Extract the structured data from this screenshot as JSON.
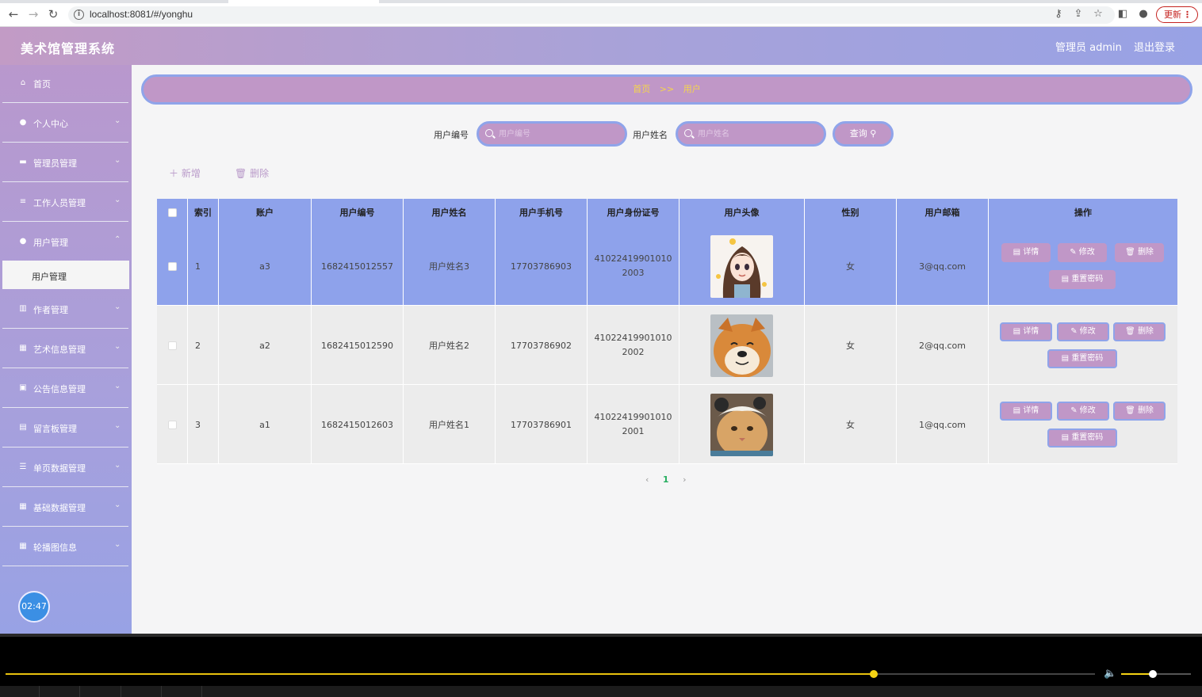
{
  "browser": {
    "url": "localhost:8081/#/yonghu",
    "update_label": "更新"
  },
  "header": {
    "title": "美术馆管理系统",
    "admin": "管理员 admin",
    "logout": "退出登录"
  },
  "sidebar": {
    "items": [
      {
        "label": "首页",
        "icon": "home-icon"
      },
      {
        "label": "个人中心",
        "icon": "user-icon"
      },
      {
        "label": "管理员管理",
        "icon": "admin-icon"
      },
      {
        "label": "工作人员管理",
        "icon": "list-icon"
      },
      {
        "label": "用户管理",
        "icon": "user-manage-icon"
      },
      {
        "label": "作者管理",
        "icon": "chart-icon"
      },
      {
        "label": "艺术信息管理",
        "icon": "grid-icon"
      },
      {
        "label": "公告信息管理",
        "icon": "notice-icon"
      },
      {
        "label": "留言板管理",
        "icon": "message-icon"
      },
      {
        "label": "单页数据管理",
        "icon": "settings-icon"
      },
      {
        "label": "基础数据管理",
        "icon": "grid-icon"
      },
      {
        "label": "轮播图信息",
        "icon": "grid-icon"
      }
    ],
    "sub_item": "用户管理",
    "clock": "02:47"
  },
  "breadcrumb": {
    "home": "首页",
    "sep": ">>",
    "current": "用户"
  },
  "search": {
    "field1_label": "用户编号",
    "field1_placeholder": "用户编号",
    "field2_label": "用户姓名",
    "field2_placeholder": "用户姓名",
    "query_label": "查询"
  },
  "actions": {
    "add": "新增",
    "delete": "删除"
  },
  "table": {
    "headers": [
      "索引",
      "账户",
      "用户编号",
      "用户姓名",
      "用户手机号",
      "用户身份证号",
      "用户头像",
      "性别",
      "用户邮箱",
      "操作"
    ],
    "rows": [
      {
        "index": "1",
        "account": "a3",
        "number": "1682415012557",
        "name": "用户姓名3",
        "phone": "17703786903",
        "id_card": "410224199010102003",
        "gender": "女",
        "email": "3@qq.com"
      },
      {
        "index": "2",
        "account": "a2",
        "number": "1682415012590",
        "name": "用户姓名2",
        "phone": "17703786902",
        "id_card": "410224199010102002",
        "gender": "女",
        "email": "2@qq.com"
      },
      {
        "index": "3",
        "account": "a1",
        "number": "1682415012603",
        "name": "用户姓名1",
        "phone": "17703786901",
        "id_card": "410224199010102001",
        "gender": "女",
        "email": "1@qq.com"
      }
    ],
    "ops": {
      "detail": "详情",
      "edit": "修改",
      "delete": "删除",
      "reset": "重置密码"
    }
  },
  "pagination": {
    "current": "1"
  },
  "player": {
    "progress": 0.797,
    "volume": 0.45
  },
  "colors": {
    "accent": "#c097c7",
    "border": "#8fa4ea",
    "breadcrumb_text": "#f4d54b"
  }
}
